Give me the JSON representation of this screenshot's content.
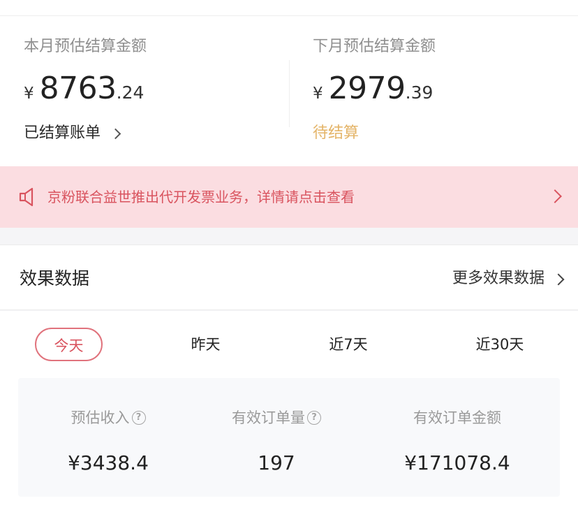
{
  "settlement": {
    "this_month": {
      "label": "本月预估结算金额",
      "currency": "¥",
      "integer": "8763",
      "decimal": ".24",
      "link_label": "已结算账单"
    },
    "next_month": {
      "label": "下月预估结算金额",
      "currency": "¥",
      "integer": "2979",
      "decimal": ".39",
      "status_label": "待结算"
    }
  },
  "notice": {
    "icon": "speaker-icon",
    "text": "京粉联合益世推出代开发票业务，详情请点击查看"
  },
  "effect": {
    "title": "效果数据",
    "more_label": "更多效果数据"
  },
  "tabs": [
    {
      "label": "今天",
      "active": true
    },
    {
      "label": "昨天",
      "active": false
    },
    {
      "label": "近7天",
      "active": false
    },
    {
      "label": "近30天",
      "active": false
    }
  ],
  "stats": [
    {
      "label": "预估收入",
      "help": "?",
      "value": "¥3438.4"
    },
    {
      "label": "有效订单量",
      "help": "?",
      "value": "197"
    },
    {
      "label": "有效订单金额",
      "value": "¥171078.4"
    }
  ],
  "colors": {
    "accent_red": "#d9545f",
    "notice_bg": "#fbdde1",
    "pending_orange": "#e4b468"
  }
}
